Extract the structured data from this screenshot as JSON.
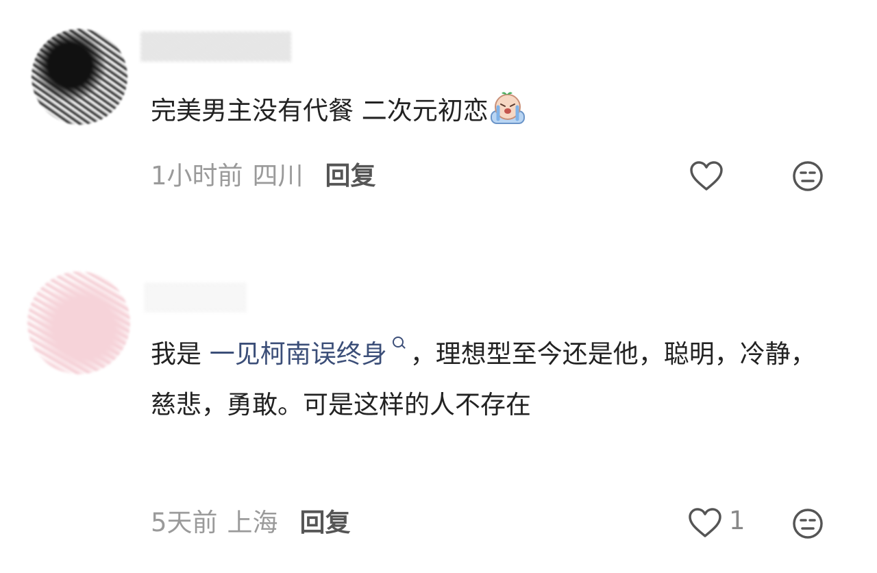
{
  "comments": [
    {
      "text": "完美男主没有代餐 二次元初恋",
      "emoji": "crying-face-emoji",
      "time": "1小时前",
      "location": "四川",
      "reply_label": "回复",
      "likes": ""
    },
    {
      "text_prefix": "我是 ",
      "link_text": "一见柯南误终身",
      "text_suffix": "，理想型至今还是他，聪明，冷静，慈悲，勇敢。可是这样的人不存在",
      "time": "5天前",
      "location": "上海",
      "reply_label": "回复",
      "likes": "1"
    }
  ],
  "icons": {
    "like": "heart-outline-icon",
    "dislike": "neutral-face-icon",
    "link": "search-link-icon"
  },
  "colors": {
    "text": "#222222",
    "meta": "#9a9a9a",
    "link": "#3b4e78",
    "icon": "#555555"
  }
}
